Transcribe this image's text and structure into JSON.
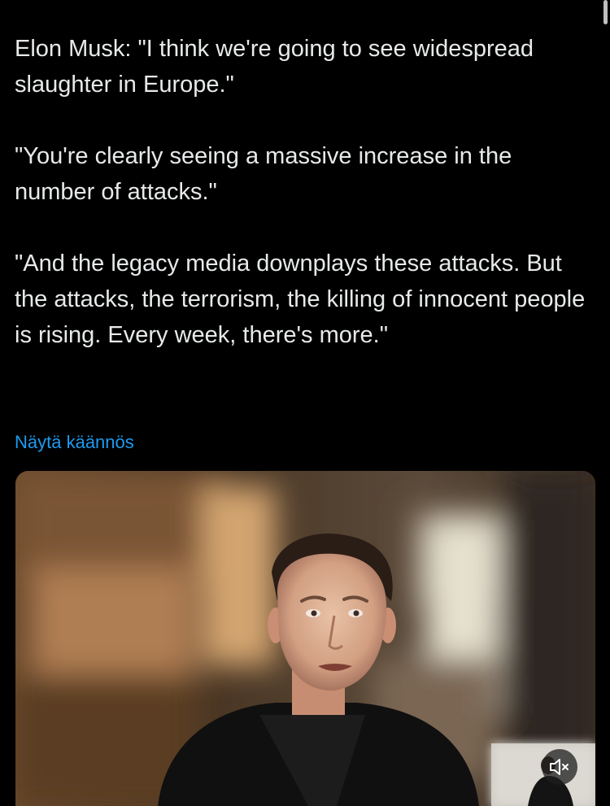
{
  "tweet": {
    "paragraphs": [
      "Elon Musk: \"I think we're going to see widespread slaughter in Europe.\"",
      "\"You're clearly seeing a massive increase in the number of attacks.\"",
      "\"And the legacy media downplays these attacks. But the attacks, the terrorism, the killing of innocent people is rising. Every week, there's more.\""
    ],
    "translate_label": "Näytä käännös"
  },
  "media": {
    "type": "video",
    "mute_icon": "speaker-muted-icon"
  },
  "colors": {
    "background": "#000000",
    "text": "#e7e9ea",
    "link": "#1d9bf0"
  }
}
